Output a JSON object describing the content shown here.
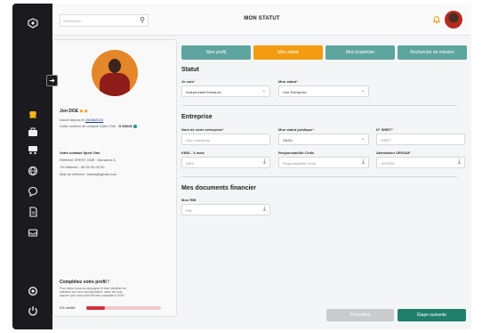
{
  "header": {
    "search_placeholder": "Rechercher",
    "title": "MON STATUT"
  },
  "colors": {
    "rail": "#1b1b1f",
    "teal": "#5ea5a0",
    "orange": "#f39c12",
    "green_button": "#1f7f6a",
    "progress_red": "#d42e3a"
  },
  "rail_icons": [
    "app-logo-icon",
    "beehive-icon",
    "briefcase-icon",
    "cart-icon",
    "globe-icon",
    "chat-icon",
    "document-icon",
    "inbox-icon",
    "settings-icon",
    "power-icon"
  ],
  "profile": {
    "name": "Jon DOE",
    "member_since_label": "Inscrit depuis le",
    "member_since_date": "19/06/2024",
    "account_number_label": "Votre numéro de compte Xpert One :",
    "account_number": "X 09213",
    "contact_title": "Votre contact Xpert One",
    "contact_name": "Référent XPERT ONE : Monsieur A.",
    "contact_phone": "Tél référent : 06 00 00 00 00",
    "contact_email": "Mail du référent : blabla@gmail.com",
    "complete_title": "Complétez votre profil !",
    "complete_text": [
      "Pour mieux vous accompagner et bien identifier les",
      "missions qui vous correspondent, merci de vous",
      "assurer que votre profil est bien complété à 100%."
    ],
    "progress_label": "0% vérifié",
    "progress_value": 0.25
  },
  "tabs": [
    {
      "label": "Mon profil",
      "active": false
    },
    {
      "label": "Mon statut",
      "active": true
    },
    {
      "label": "Mon Expertise",
      "active": false
    },
    {
      "label": "Recherche de mission",
      "active": false
    }
  ],
  "statut": {
    "title": "Statut",
    "je_suis_label": "Je suis",
    "je_suis_value": "Indépendant freelance",
    "mon_statut_label": "Mon statut",
    "mon_statut_value": "Une Entreprise"
  },
  "entreprise": {
    "title": "Entreprise",
    "nom_label": "Nom de votre entreprise",
    "nom_placeholder": "Nom entreprise",
    "juridique_label": "Mon statut juridique",
    "juridique_value": "SASU",
    "siret_label": "N° SIRET",
    "siret_placeholder": "SIRET",
    "kbis_label": "KBIS - 3 mois",
    "kbis_placeholder": "KBIS",
    "rc_label": "Responsabilité Civile",
    "rc_placeholder": "Responsabilité Civile",
    "urssaf_label": "Attestation URSSAF",
    "urssaf_placeholder": "URSSAF"
  },
  "documents": {
    "title": "Mes documents financier",
    "rib_label": "Mon RIB",
    "rib_placeholder": "RIB"
  },
  "footer": {
    "previous": "Précédent",
    "next": "Étape suivante"
  }
}
